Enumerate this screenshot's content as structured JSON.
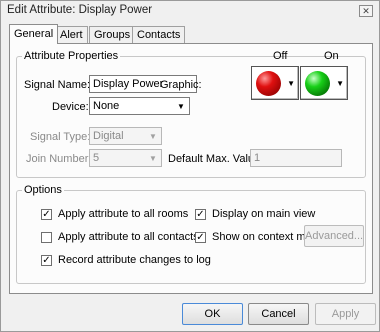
{
  "window": {
    "title": "Edit Attribute: Display Power",
    "close_glyph": "✕"
  },
  "tabs": [
    {
      "label": "General",
      "active": true
    },
    {
      "label": "Alert",
      "active": false
    },
    {
      "label": "Groups",
      "active": false
    },
    {
      "label": "Contacts",
      "active": false
    }
  ],
  "attribute_properties": {
    "legend": "Attribute Properties",
    "signal_name_label": "Signal Name:",
    "signal_name_value": "Display Power",
    "device_label": "Device:",
    "device_value": "None",
    "signal_type_label": "Signal Type:",
    "signal_type_value": "Digital",
    "join_number_label": "Join Number:",
    "join_number_value": "5",
    "default_max_label": "Default Max. Value:",
    "default_max_value": "1",
    "graphic_label": "Graphic:",
    "graphic_off_label": "Off",
    "graphic_on_label": "On"
  },
  "options": {
    "legend": "Options",
    "checkboxes": [
      {
        "label": "Apply attribute to all rooms",
        "checked": true
      },
      {
        "label": "Apply attribute to all contacts",
        "checked": false
      },
      {
        "label": "Record attribute changes to log",
        "checked": true
      },
      {
        "label": "Display on main view",
        "checked": true
      },
      {
        "label": "Show on context menu",
        "checked": true
      }
    ],
    "advanced_label": "Advanced..."
  },
  "footer": {
    "ok_label": "OK",
    "cancel_label": "Cancel",
    "apply_label": "Apply"
  },
  "icons": {
    "dropdown": "chevron-down-icon",
    "check": "checkmark-icon"
  },
  "colors": {
    "graphic_off": "#e01010",
    "graphic_on": "#18d018",
    "focus_border": "#4a8ad8"
  }
}
